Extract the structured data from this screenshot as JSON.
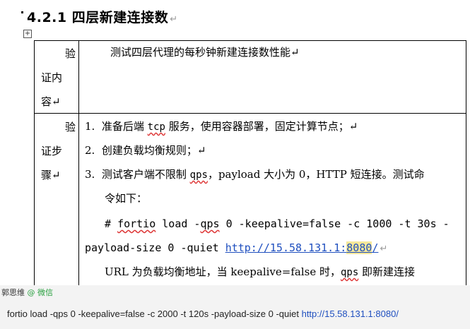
{
  "section": {
    "heading": "4.2.1 四层新建连接数",
    "para_mark": "↵"
  },
  "table": {
    "row1": {
      "label_lines": [
        "验",
        "证内",
        "容↵"
      ],
      "content": "测试四层代理的每秒钟新建连接数性能↵"
    },
    "row2": {
      "label_lines": [
        "验",
        "证步",
        "骤↵"
      ],
      "steps": [
        {
          "num": "1.",
          "text_a": "准备后端 ",
          "code": "tcp",
          "text_b": " 服务，使用容器部署，固定计算节点；↵"
        },
        {
          "num": "2.",
          "text": "创建负载均衡规则；↵"
        },
        {
          "num": "3.",
          "text_a": "测试客户端不限制 ",
          "code": "qps",
          "text_b": "，payload 大小为 0，HTTP 短连接。测试命",
          "text_c": "令如下："
        }
      ],
      "command_line1_a": "# ",
      "command_line1_b": "fortio",
      "command_line1_c": " load -",
      "command_line1_d": "qps",
      "command_line1_e": " 0 -keepalive=false -c 1000 -t 30s -",
      "command_line2_a": "payload-size 0 -quiet ",
      "command_url_a": "http://15.58.131.1:",
      "command_url_port": "8080",
      "command_url_b": "/",
      "note_a": "URL 为负载均衡地址，当 keepalive=false 时，",
      "note_code": "qps",
      "note_b": " 即新建连接"
    }
  },
  "comment": {
    "author": "郭思维",
    "via": "@ 微信",
    "text": "fortio load -qps 0 -keepalive=false -c 2000 -t 120s -payload-size 0 -quiet ",
    "url": "http://15.58.131.1:8080/"
  }
}
